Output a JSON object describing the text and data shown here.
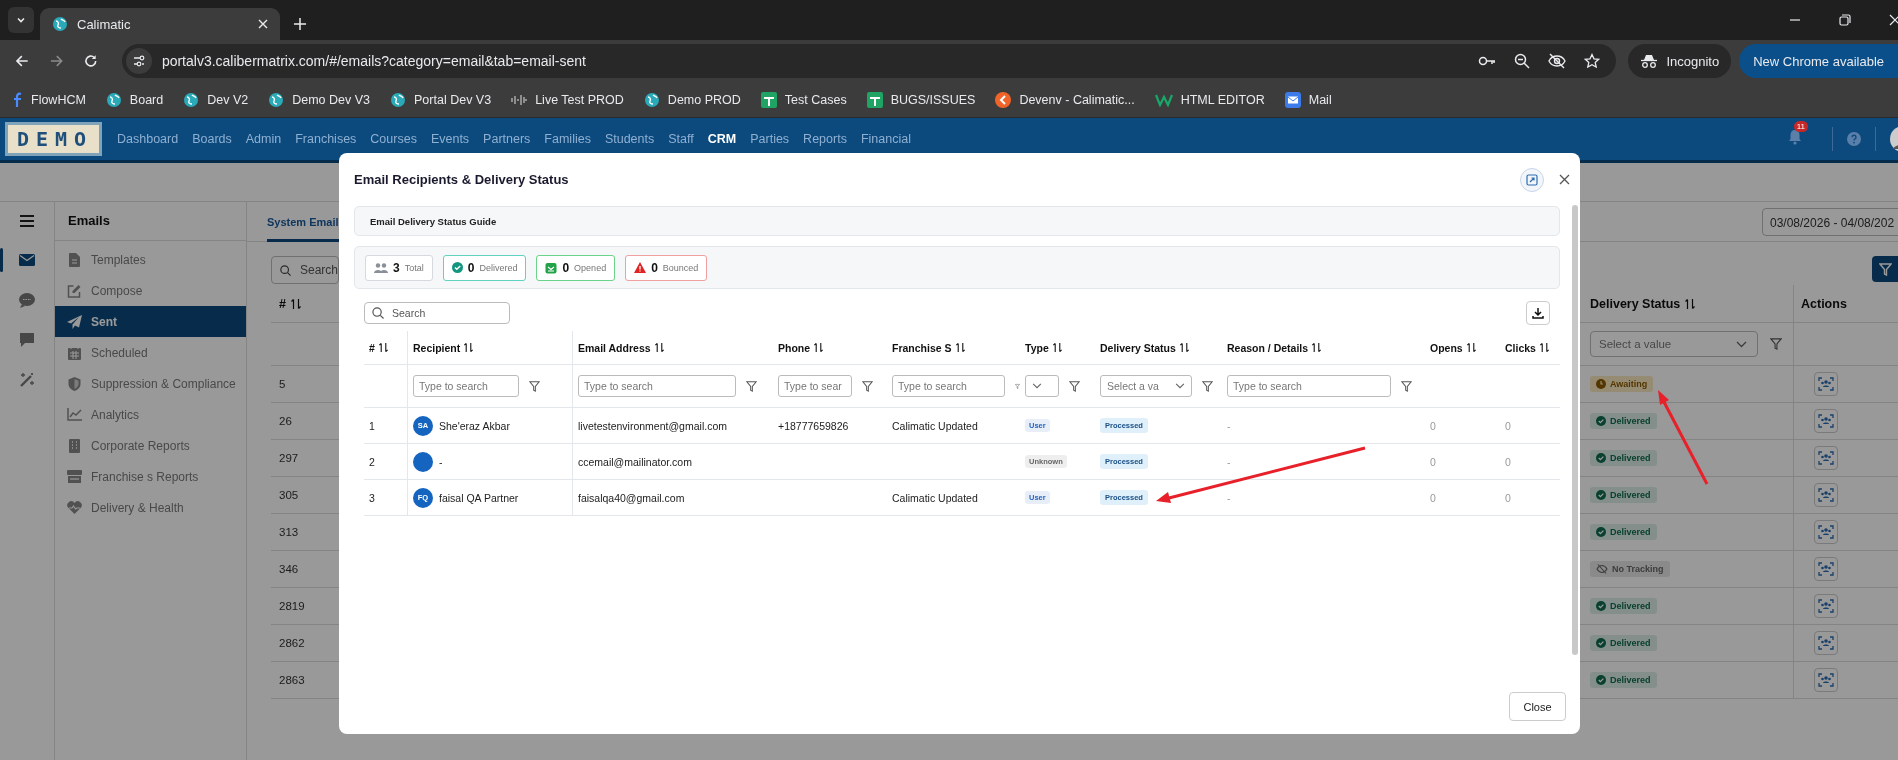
{
  "browser": {
    "tabs": [
      {
        "title": "Calimatic",
        "selected": true
      }
    ],
    "address": "portalv3.calibermatrix.com/#/emails?category=email&tab=email-sent",
    "incognito_label": "Incognito",
    "update_button": "New Chrome available",
    "bookmarks": [
      {
        "label": "FlowHCM",
        "kind": "flow"
      },
      {
        "label": "Board",
        "kind": "globe"
      },
      {
        "label": "Dev V2",
        "kind": "globe"
      },
      {
        "label": "Demo Dev V3",
        "kind": "globe"
      },
      {
        "label": "Portal Dev V3",
        "kind": "globe"
      },
      {
        "label": "Live Test PROD",
        "kind": "wave"
      },
      {
        "label": "Demo PROD",
        "kind": "globe"
      },
      {
        "label": "Test Cases",
        "kind": "sheet"
      },
      {
        "label": "BUGS/ISSUES",
        "kind": "sheet"
      },
      {
        "label": "Devenv - Calimatic...",
        "kind": "orange"
      },
      {
        "label": "HTML EDITOR",
        "kind": "w"
      },
      {
        "label": "Mail",
        "kind": "mail"
      }
    ]
  },
  "app": {
    "logo": "DEMO",
    "notification_count": "11",
    "nav": [
      {
        "label": "Dashboard",
        "selected": false
      },
      {
        "label": "Boards",
        "selected": false
      },
      {
        "label": "Admin",
        "selected": false
      },
      {
        "label": "Franchises",
        "selected": false
      },
      {
        "label": "Courses",
        "selected": false
      },
      {
        "label": "Events",
        "selected": false
      },
      {
        "label": "Partners",
        "selected": false
      },
      {
        "label": "Families",
        "selected": false
      },
      {
        "label": "Students",
        "selected": false
      },
      {
        "label": "Staff",
        "selected": false
      },
      {
        "label": "CRM",
        "selected": true
      },
      {
        "label": "Parties",
        "selected": false
      },
      {
        "label": "Reports",
        "selected": false
      },
      {
        "label": "Financial",
        "selected": false
      }
    ]
  },
  "rail": [
    {
      "kind": "mail",
      "selected": true
    },
    {
      "kind": "sms",
      "selected": false
    },
    {
      "kind": "chat",
      "selected": false
    },
    {
      "kind": "magic",
      "selected": false
    }
  ],
  "sidebar": {
    "title": "Emails",
    "items": [
      {
        "label": "Templates",
        "kind": "file",
        "selected": false
      },
      {
        "label": "Compose",
        "kind": "edit",
        "selected": false
      },
      {
        "label": "Sent",
        "kind": "send",
        "selected": true
      },
      {
        "label": "Scheduled",
        "kind": "calendar",
        "selected": false
      },
      {
        "label": "Suppression & Compliance",
        "kind": "shield",
        "selected": false
      },
      {
        "label": "Analytics",
        "kind": "chart",
        "selected": false
      },
      {
        "label": "Corporate Reports",
        "kind": "building",
        "selected": false
      },
      {
        "label": "Franchise s Reports",
        "kind": "store",
        "selected": false
      },
      {
        "label": "Delivery & Health",
        "kind": "heart",
        "selected": false
      }
    ]
  },
  "content": {
    "tabs": [
      {
        "label": "System Email",
        "selected": true
      }
    ],
    "date_range": "03/08/2026 - 04/08/202",
    "search_placeholder": "Search",
    "table": {
      "columns": [
        {
          "label": "#",
          "sortable": true
        },
        {
          "label": "Delivery Status",
          "sortable": true
        },
        {
          "label": "Actions",
          "sortable": false
        }
      ],
      "status_filter_placeholder": "Select a value",
      "rows": [
        {
          "id": "5",
          "status": "Awaiting",
          "kind": "awaiting"
        },
        {
          "id": "26",
          "status": "Delivered",
          "kind": "delivered"
        },
        {
          "id": "297",
          "status": "Delivered",
          "kind": "delivered"
        },
        {
          "id": "305",
          "status": "Delivered",
          "kind": "delivered"
        },
        {
          "id": "313",
          "status": "Delivered",
          "kind": "delivered"
        },
        {
          "id": "346",
          "status": "No Tracking",
          "kind": "no_tracking"
        },
        {
          "id": "2819",
          "status": "Delivered",
          "kind": "delivered"
        },
        {
          "id": "2862",
          "status": "Delivered",
          "kind": "delivered"
        },
        {
          "id": "2863",
          "status": "Delivered",
          "kind": "delivered"
        }
      ]
    }
  },
  "modal": {
    "title": "Email Recipients & Delivery Status",
    "guide": "Email Delivery Status Guide",
    "stats": [
      {
        "count": "3",
        "label": "Total",
        "kind": "total"
      },
      {
        "count": "0",
        "label": "Delivered",
        "kind": "delivered"
      },
      {
        "count": "0",
        "label": "Opened",
        "kind": "opened"
      },
      {
        "count": "0",
        "label": "Bounced",
        "kind": "bounced"
      }
    ],
    "search_placeholder": "Search",
    "columns": [
      {
        "label": "#",
        "kind": "none"
      },
      {
        "label": "Recipient",
        "kind": "text",
        "placeholder": "Type to search"
      },
      {
        "label": "Email Address",
        "kind": "text",
        "placeholder": "Type to search"
      },
      {
        "label": "Phone",
        "kind": "text",
        "placeholder": "Type to sear"
      },
      {
        "label": "Franchise S",
        "kind": "text",
        "placeholder": "Type to search"
      },
      {
        "label": "Type",
        "kind": "select"
      },
      {
        "label": "Delivery Status",
        "kind": "select",
        "placeholder": "Select a va"
      },
      {
        "label": "Reason / Details",
        "kind": "text",
        "placeholder": "Type to search"
      },
      {
        "label": "Opens",
        "kind": "none"
      },
      {
        "label": "Clicks",
        "kind": "none"
      }
    ],
    "rows": [
      {
        "index": "1",
        "initials": "SA",
        "recipient": "She'eraz Akbar",
        "email": "livetestenvironment@gmail.com",
        "phone": "+18777659826",
        "franchise": "Calimatic Updated",
        "type": "User",
        "color": "#2563c0",
        "delivery_status": "Processed",
        "reason": "-",
        "opens": "0",
        "clicks": "0"
      },
      {
        "index": "2",
        "recipient": "-",
        "email": "ccemail@mailinator.com",
        "type": "Unknown",
        "color": "#666666",
        "delivery_status": "Processed",
        "reason": "-",
        "opens": "0",
        "clicks": "0"
      },
      {
        "index": "3",
        "initials": "FQ",
        "recipient": "faisal QA Partner",
        "email": "faisalqa40@gmail.com",
        "franchise": "Calimatic Updated",
        "type": "User",
        "color": "#2563c0",
        "delivery_status": "Processed",
        "reason": "-",
        "opens": "0",
        "clicks": "0"
      }
    ],
    "close_button": "Close"
  }
}
